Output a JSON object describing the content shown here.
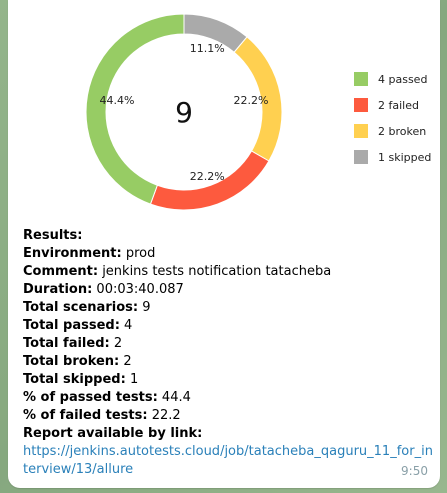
{
  "chart_data": {
    "type": "pie",
    "center_label": "9",
    "categories": [
      "4 passed",
      "2 failed",
      "2 broken",
      "1 skipped"
    ],
    "values": [
      44.4,
      22.2,
      22.2,
      11.1
    ],
    "slice_labels": [
      "44.4%",
      "22.2%",
      "22.2%",
      "11.1%"
    ],
    "colors": [
      "#97cc64",
      "#fd5a3e",
      "#ffd050",
      "#aaaaaa"
    ],
    "legend_position": "right"
  },
  "message": {
    "results_label": "Results:",
    "environment_label": "Environment:",
    "environment_value": " prod",
    "comment_label": "Comment:",
    "comment_value": " jenkins tests notification tatacheba",
    "duration_label": "Duration:",
    "duration_value": " 00:03:40.087",
    "total_scenarios_label": "Total scenarios:",
    "total_scenarios_value": " 9",
    "total_passed_label": "Total passed:",
    "total_passed_value": " 4",
    "total_failed_label": "Total failed:",
    "total_failed_value": " 2",
    "total_broken_label": "Total broken:",
    "total_broken_value": " 2",
    "total_skipped_label": "Total skipped:",
    "total_skipped_value": " 1",
    "pct_passed_label": "% of passed tests:",
    "pct_passed_value": " 44.4",
    "pct_failed_label": "% of failed tests:",
    "pct_failed_value": " 22.2",
    "report_label": "Report available by link:",
    "report_link": "https://jenkins.autotests.cloud/job/tatacheba_qaguru_11_for_interview/13/allure",
    "time": "9:50"
  }
}
